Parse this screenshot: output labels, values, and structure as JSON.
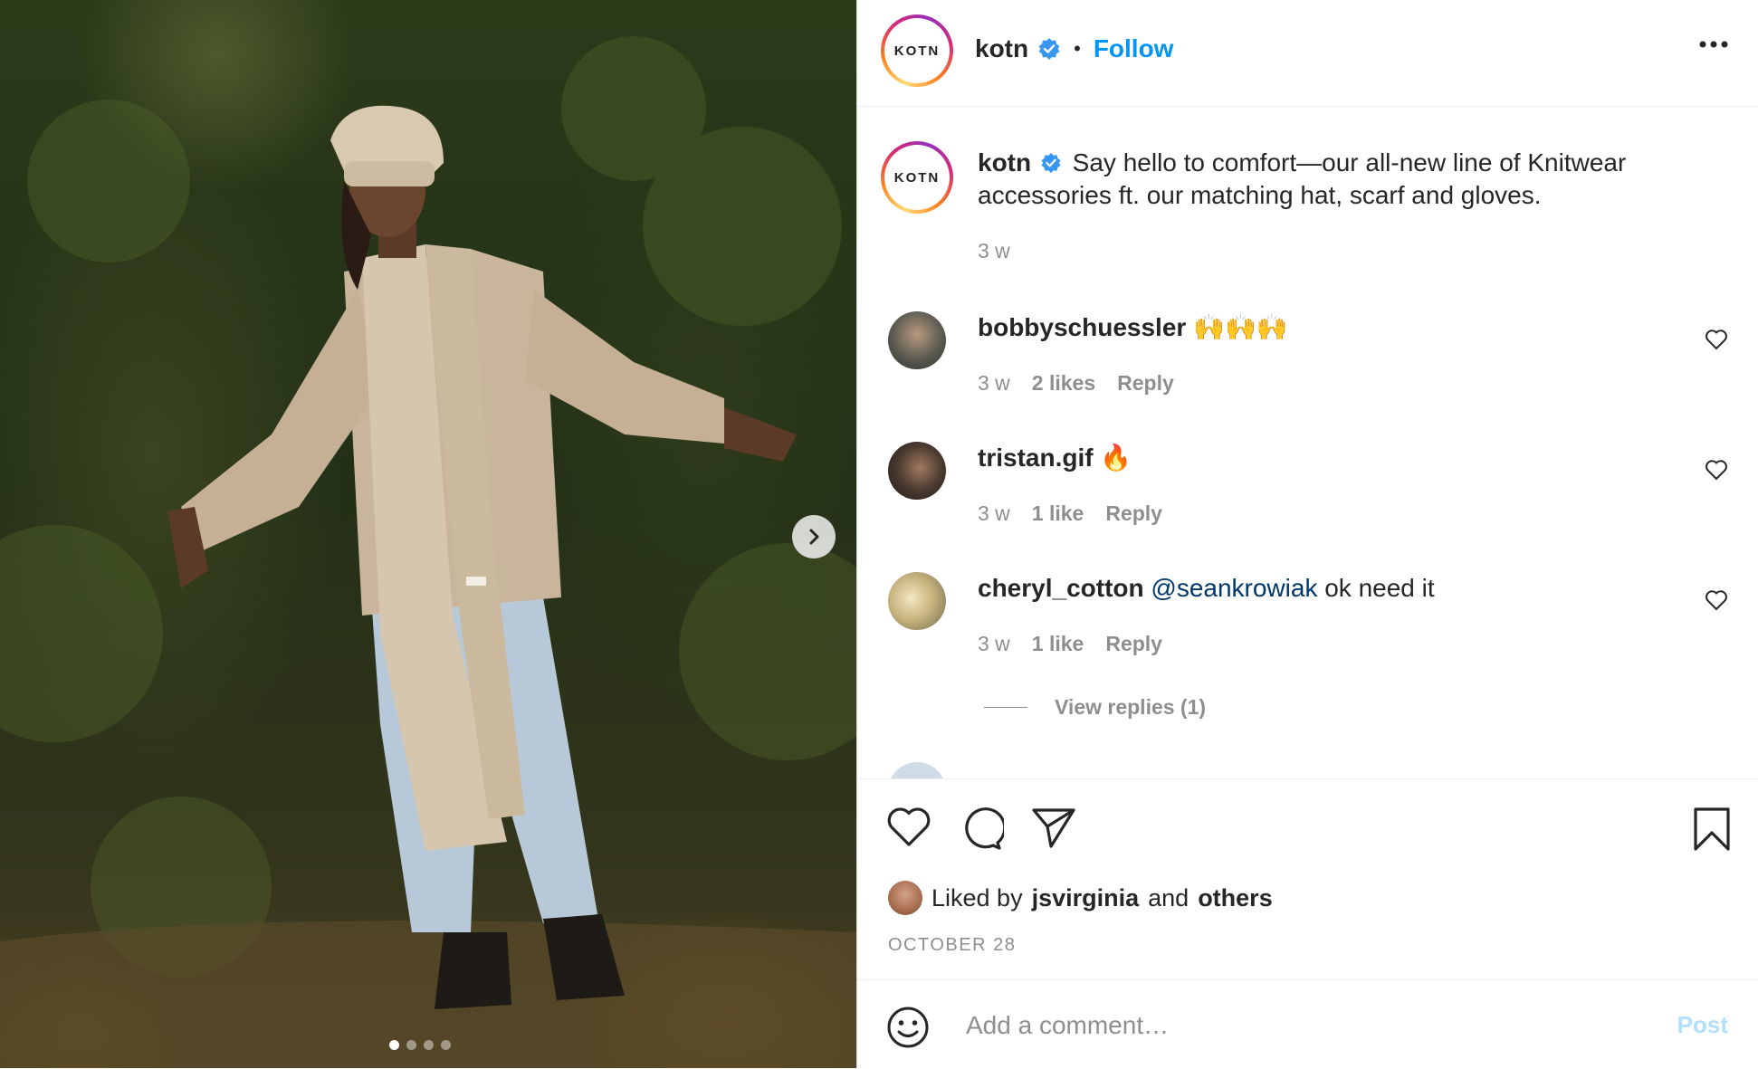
{
  "post": {
    "carousel": {
      "total_slides": 4,
      "active_slide": 1
    }
  },
  "header": {
    "avatar_text": "KOTN",
    "username": "kotn",
    "separator": "•",
    "follow_label": "Follow"
  },
  "caption": {
    "avatar_text": "KOTN",
    "username": "kotn",
    "text": "Say hello to comfort—our all-new line of Knitwear accessories ft. our matching hat, scarf and gloves.",
    "time": "3 w"
  },
  "comments": [
    {
      "username": "bobbyschuessler",
      "text": "🙌🙌🙌",
      "time": "3 w",
      "likes": "2 likes",
      "reply": "Reply"
    },
    {
      "username": "tristan.gif",
      "text": "🔥",
      "time": "3 w",
      "likes": "1 like",
      "reply": "Reply"
    },
    {
      "username": "cheryl_cotton",
      "mention": "@seankrowiak",
      "text": "ok need it",
      "time": "3 w",
      "likes": "1 like",
      "reply": "Reply",
      "view_replies": "View replies (1)"
    }
  ],
  "likes": {
    "prefix": "Liked by",
    "user": "jsvirginia",
    "middle": "and",
    "others": "others"
  },
  "date": "OCTOBER 28",
  "add_comment": {
    "placeholder": "Add a comment…",
    "post_label": "Post"
  },
  "colors": {
    "accent": "#0095f6",
    "muted": "#8e8e8e",
    "mention": "#00376b",
    "post_disabled": "#b2dffc"
  }
}
